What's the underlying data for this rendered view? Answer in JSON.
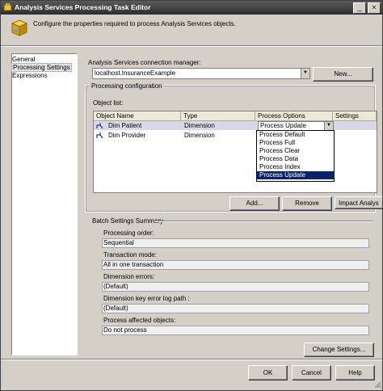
{
  "window": {
    "title": "Analysis Services Processing Task Editor"
  },
  "header": {
    "description": "Configure the properties required to process Analysis Services objects."
  },
  "nav": {
    "items": [
      "General",
      "Processing Settings",
      "Expressions"
    ],
    "selected": "Processing Settings"
  },
  "connection": {
    "label": "Analysis Services connection manager:",
    "value": "localhost.InsuranceExample",
    "new_button": "New..."
  },
  "processing_configuration": {
    "title": "Processing configuration",
    "object_list_label": "Object list:",
    "columns": [
      "Object Name",
      "Type",
      "Process Options",
      "Settings"
    ],
    "rows": [
      {
        "name": "Dim Patient",
        "type": "Dimension",
        "process_option": "Process Update"
      },
      {
        "name": "Dim Provider",
        "type": "Dimension",
        "process_option": ""
      }
    ],
    "dropdown_options": [
      "Process Default",
      "Process Full",
      "Process Clear",
      "Process Data",
      "Process Index",
      "Process Update"
    ],
    "dropdown_selected": "Process Update",
    "buttons": {
      "add": "Add...",
      "remove": "Remove",
      "impact": "Impact Analys"
    }
  },
  "batch_settings": {
    "title": "Batch Settings Summary",
    "fields": [
      {
        "label": "Processing order:",
        "value": "Sequential"
      },
      {
        "label": "Transaction mode:",
        "value": "All in one transaction"
      },
      {
        "label": "Dimension errors:",
        "value": "(Default)"
      },
      {
        "label": "Dimension key error log path :",
        "value": "(Default)"
      },
      {
        "label": "Process affected objects:",
        "value": "Do not process"
      }
    ],
    "change_button": "Change Settings..."
  },
  "footer": {
    "ok": "OK",
    "cancel": "Cancel",
    "help": "Help"
  },
  "colors": {
    "titlebar": "#3a3a3a",
    "selection": "#0a246a",
    "face": "#d4d0c8"
  }
}
